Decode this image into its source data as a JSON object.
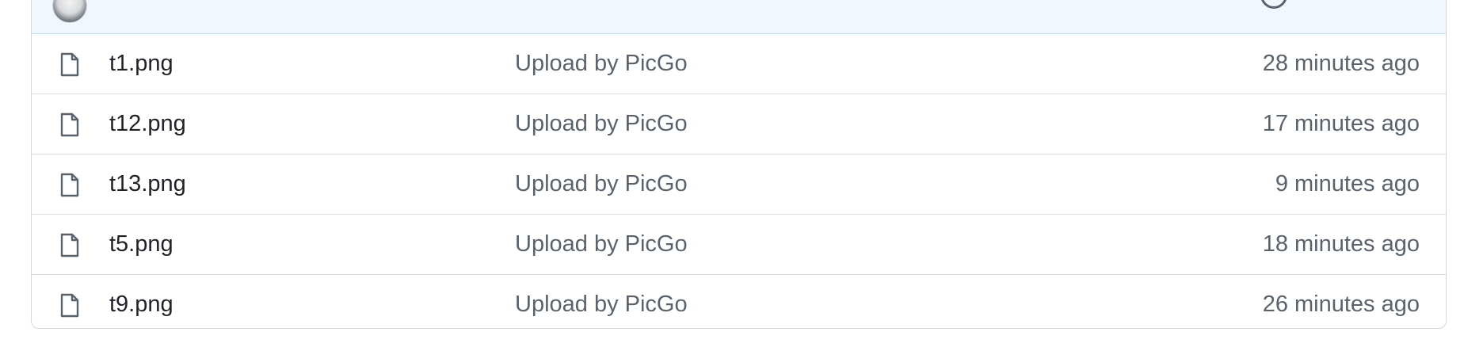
{
  "files": [
    {
      "name": "t1.png",
      "message": "Upload by PicGo",
      "age": "28 minutes ago"
    },
    {
      "name": "t12.png",
      "message": "Upload by PicGo",
      "age": "17 minutes ago"
    },
    {
      "name": "t13.png",
      "message": "Upload by PicGo",
      "age": "9 minutes ago"
    },
    {
      "name": "t5.png",
      "message": "Upload by PicGo",
      "age": "18 minutes ago"
    },
    {
      "name": "t9.png",
      "message": "Upload by PicGo",
      "age": "26 minutes ago"
    }
  ],
  "icons": {
    "file": "file-icon",
    "avatar": "avatar",
    "history": "history-icon"
  },
  "colors": {
    "header_bg": "#f0f7ff",
    "border": "#d0d7de",
    "text_primary": "#1f2328",
    "text_muted": "#59636e"
  }
}
